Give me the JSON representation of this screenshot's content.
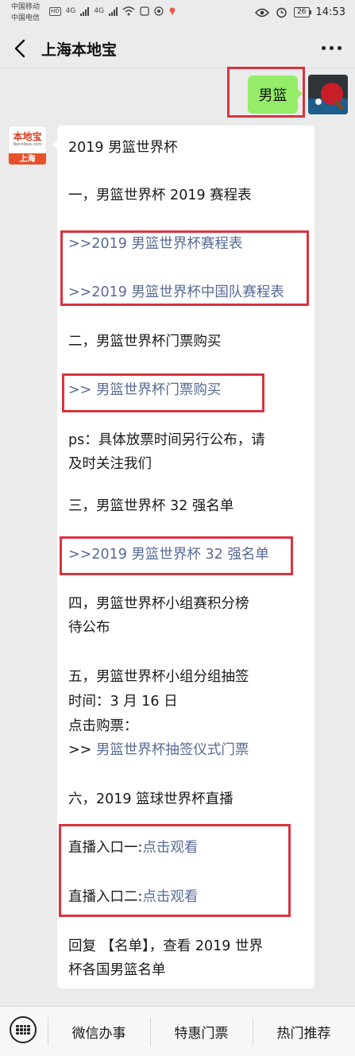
{
  "status_bar": {
    "carrier_1": "中国移动",
    "carrier_2": "中国电信",
    "hd_badge": "HD",
    "network_1": "4G",
    "network_2": "4G",
    "battery": "26",
    "time": "14:53"
  },
  "nav": {
    "title": "上海本地宝"
  },
  "sent_message": {
    "text": "男篮"
  },
  "bot_avatar": {
    "logo_text": "本地宝",
    "logo_domain": "Bendibao.com",
    "city": "上海"
  },
  "reply": {
    "title": "2019 男篮世界杯",
    "section_1": "一，男篮世界杯 2019 赛程表",
    "link_1_prefix": ">>",
    "link_1": "2019 男篮世界杯赛程表",
    "link_2_prefix": ">>",
    "link_2": "2019 男篮世界杯中国队赛程表",
    "section_2": "二，男篮世界杯门票购买",
    "link_3_prefix": ">> ",
    "link_3": "男篮世界杯门票购买",
    "ps_line_1": "ps：具体放票时间另行公布，请",
    "ps_line_2": "及时关注我们",
    "section_3": "三，男篮世界杯 32 强名单",
    "link_4_prefix": ">>",
    "link_4": "2019 男篮世界杯 32 强名单",
    "section_4_line_1": "四，男篮世界杯小组赛积分榜",
    "section_4_line_2": "待公布",
    "section_5_line_1": "五，男篮世界杯小组分组抽签",
    "section_5_line_2": "时间：3 月 16 日",
    "section_5_line_3": "点击购票：",
    "link_5_prefix": ">> ",
    "link_5": "男篮世界杯抽签仪式门票",
    "section_6": "六，2019 篮球世界杯直播",
    "live_1_label": "直播入口一:",
    "live_1_link": "点击观看",
    "live_2_label": "直播入口二:",
    "live_2_link": "点击观看",
    "footer_line_1": "回复 【名单】，查看 2019 世界",
    "footer_line_2": "杯各国男篮名单"
  },
  "bottom_menu": {
    "items": [
      "微信办事",
      "特惠门票",
      "热门推荐"
    ]
  },
  "colors": {
    "link": "#576b95",
    "highlight_box": "#d9333f",
    "sent_bubble": "#95ec69"
  }
}
